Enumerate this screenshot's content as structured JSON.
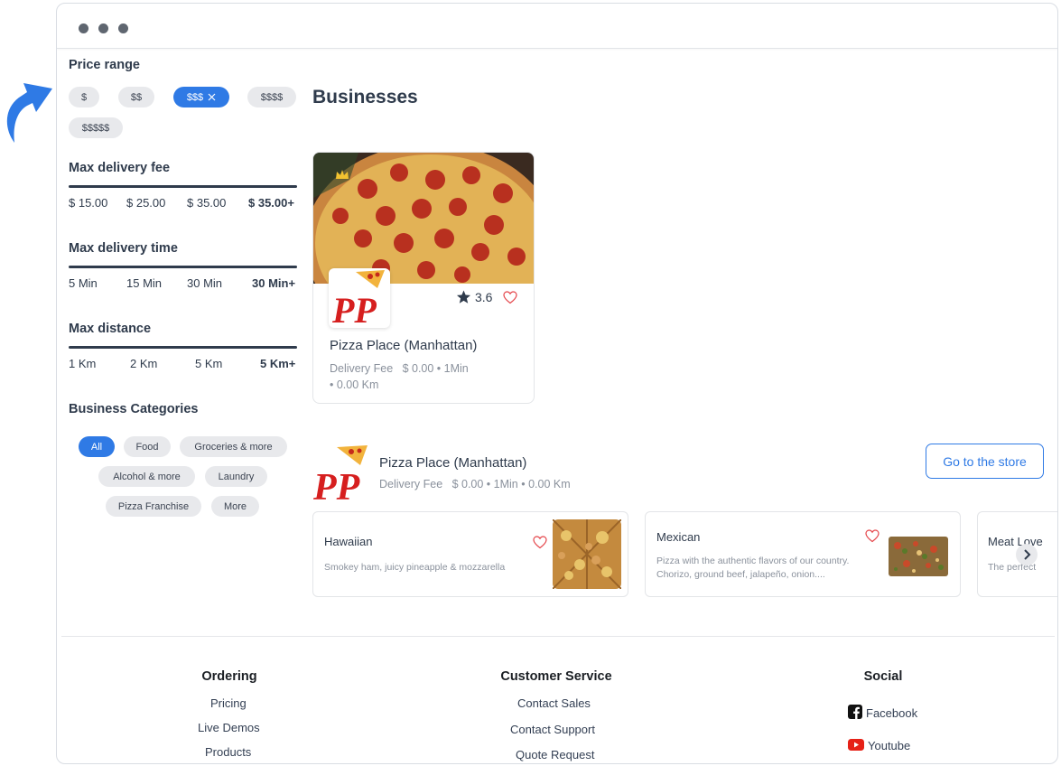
{
  "window": {
    "controls": [
      "close",
      "minimize",
      "maximize"
    ]
  },
  "filters": {
    "price_range": {
      "title": "Price range",
      "options": [
        "$",
        "$$",
        "$$$",
        "$$$$",
        "$$$$$"
      ],
      "active_label": "$$$",
      "remove_icon": "close-icon"
    },
    "delivery_fee": {
      "title": "Max delivery fee",
      "ticks": [
        "$ 15.00",
        "$ 25.00",
        "$ 35.00",
        "$ 35.00+"
      ],
      "selected": "$ 35.00+"
    },
    "delivery_time": {
      "title": "Max delivery time",
      "ticks": [
        "5 Min",
        "15 Min",
        "30 Min",
        "30 Min+"
      ],
      "selected": "30 Min+"
    },
    "distance": {
      "title": "Max distance",
      "ticks": [
        "1 Km",
        "2 Km",
        "5 Km",
        "5 Km+"
      ],
      "selected": "5 Km+"
    },
    "categories": {
      "title": "Business Categories",
      "items": [
        "All",
        "Food",
        "Groceries & more",
        "Alcohol & more",
        "Laundry",
        "Pizza Franchise",
        "More"
      ],
      "selected": "All"
    }
  },
  "main": {
    "heading": "Businesses",
    "business_card": {
      "name": "Pizza Place (Manhattan)",
      "rating": "3.6",
      "delivery_line": "Delivery Fee   $ 0.00 • 1Min",
      "distance_line": "• 0.00 Km",
      "logo_text": "PP"
    },
    "store_row": {
      "name": "Pizza Place (Manhattan)",
      "details": "Delivery Fee   $ 0.00 • 1Min • 0.00 Km",
      "button": "Go to the store",
      "logo_text": "PP",
      "products": [
        {
          "title": "Hawaiian",
          "desc": "Smokey ham, juicy pineapple & mozzarella"
        },
        {
          "title": "Mexican",
          "desc_line1": "Pizza with the authentic flavors of our country.",
          "desc_line2": "Chorizo, ground beef, jalapeño, onion...."
        },
        {
          "title": "Meat Love",
          "desc": "The perfect"
        }
      ]
    }
  },
  "footer": {
    "ordering": {
      "title": "Ordering",
      "items": [
        "Pricing",
        "Live Demos",
        "Products"
      ]
    },
    "customer_service": {
      "title": "Customer Service",
      "items": [
        "Contact Sales",
        "Contact Support",
        "Quote Request"
      ]
    },
    "social": {
      "title": "Social",
      "items": [
        "Facebook",
        "Youtube"
      ]
    }
  },
  "colors": {
    "accent": "#2f7ae5",
    "text_dark": "#2f3b4c",
    "muted": "#8a919c",
    "heart": "#e5484d",
    "logo_red": "#d61f1f"
  }
}
